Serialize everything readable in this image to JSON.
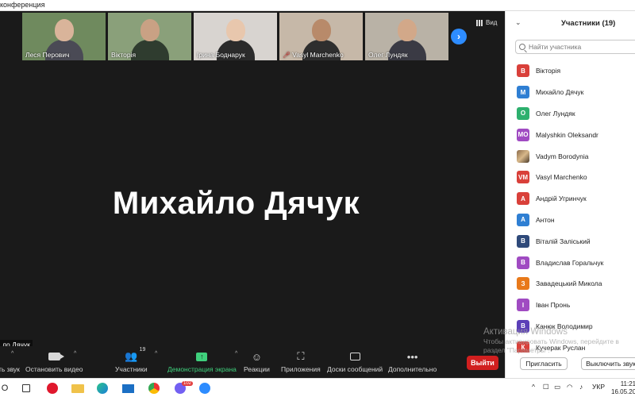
{
  "window": {
    "title": "конференция"
  },
  "thumbnails": [
    {
      "name": "Леся Перович",
      "muted": false,
      "bg": "#6f8a5e",
      "skin": "#d9b49a",
      "cloth": "#4a4a55"
    },
    {
      "name": "Вікторія",
      "muted": false,
      "bg": "#8aa07a",
      "skin": "#c9a184",
      "cloth": "#2f3c2f"
    },
    {
      "name": "Ірина Боднарук",
      "muted": false,
      "bg": "#d8d4d0",
      "skin": "#e8c7ad",
      "cloth": "#2b2b2b"
    },
    {
      "name": "Vasyl Marchenko",
      "muted": true,
      "bg": "#c6b8a8",
      "skin": "#b88a6a",
      "cloth": "#2e2e2e"
    },
    {
      "name": "Олег Лундяк",
      "muted": false,
      "bg": "#b9b2a6",
      "skin": "#d2a889",
      "cloth": "#3a3a44"
    }
  ],
  "view_button": {
    "label": "Вид",
    "icon": "grid-view-icon"
  },
  "next_page_icon": "chevron-right-icon",
  "active_speaker": "Михайло Дячук",
  "self_view_label": "ло Дячук",
  "toolbar": {
    "audio": {
      "label": "ть звук",
      "icon": "microphone-icon"
    },
    "video": {
      "label": "Остановить видео",
      "icon": "camera-icon"
    },
    "participants": {
      "label": "Участники",
      "count": "19",
      "icon": "participants-icon"
    },
    "share": {
      "label": "Демонстрация экрана",
      "icon": "share-screen-icon"
    },
    "reactions": {
      "label": "Реакции",
      "icon": "smile-icon"
    },
    "apps": {
      "label": "Приложения",
      "icon": "apps-icon"
    },
    "whiteboards": {
      "label": "Доски сообщений",
      "icon": "whiteboard-icon"
    },
    "more": {
      "label": "Дополнительно",
      "icon": "more-icon"
    },
    "leave": {
      "label": "Выйти"
    }
  },
  "panel": {
    "title": "Участники (19)",
    "search_placeholder": "Найти участника",
    "participants": [
      {
        "initials": "В",
        "name": "Вікторія",
        "color": "#d9403a"
      },
      {
        "initials": "М",
        "name": "Михайло Дячук",
        "color": "#2f7fd3"
      },
      {
        "initials": "О",
        "name": "Олег Лундяк",
        "color": "#2db06e"
      },
      {
        "initials": "МО",
        "name": "Malyshkin Oleksandr",
        "color": "#a04bc2"
      },
      {
        "initials": "",
        "name": "Vadym Borodynia",
        "color": "photo"
      },
      {
        "initials": "VM",
        "name": "Vasyl Marchenko",
        "color": "#d9403a"
      },
      {
        "initials": "А",
        "name": "Андрій Угринчук",
        "color": "#d9403a"
      },
      {
        "initials": "А",
        "name": "Антон",
        "color": "#2f7fd3"
      },
      {
        "initials": "В",
        "name": "Віталій Заліський",
        "color": "#2f4a7a"
      },
      {
        "initials": "В",
        "name": "Владислав Горальчук",
        "color": "#a04bc2"
      },
      {
        "initials": "З",
        "name": "Завадецький Микола",
        "color": "#e8791a"
      },
      {
        "initials": "І",
        "name": "Іван Пронь",
        "color": "#a04bc2"
      },
      {
        "initials": "В",
        "name": "Канюк Володимир",
        "color": "#5b3fb8"
      },
      {
        "initials": "К",
        "name": "Кучерак Руслан",
        "color": "#d9403a"
      }
    ],
    "invite_label": "Пригласить",
    "mute_all_label": "Выключить звук"
  },
  "watermark": {
    "line1": "Активация Windows",
    "line2": "Чтобы активировать Windows, перейдите в",
    "line3": "раздел \"Параметры\"."
  },
  "taskbar": {
    "viber_badge": "102",
    "tray_lang": "УКР",
    "time": "11:21",
    "date": "16.05.20"
  }
}
